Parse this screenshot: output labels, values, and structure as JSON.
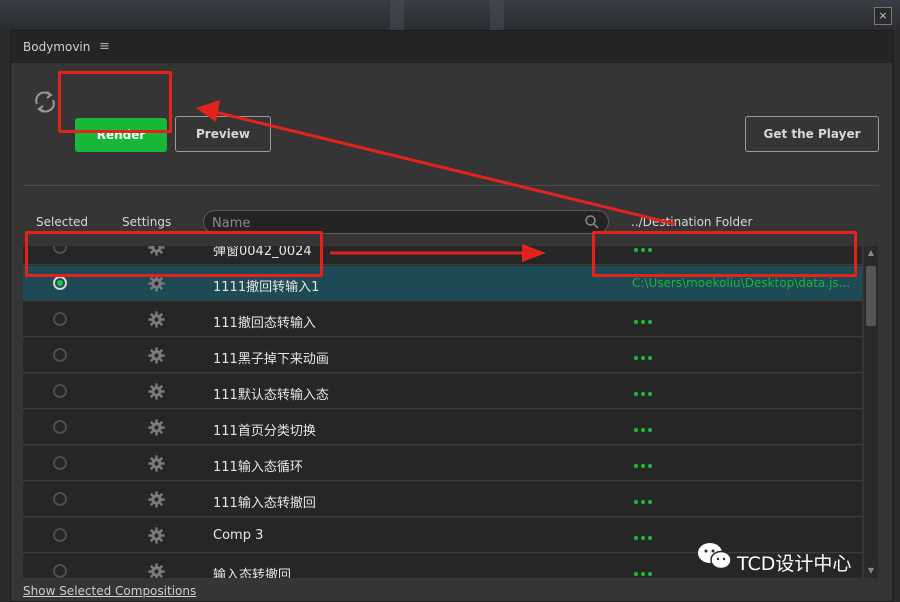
{
  "panel": {
    "title": "Bodymovin",
    "menu_icon": "≡",
    "close_icon": "×"
  },
  "toolbar": {
    "render_label": "Render",
    "preview_label": "Preview",
    "player_label": "Get the Player"
  },
  "columns": {
    "selected": "Selected",
    "settings": "Settings",
    "name_placeholder": "Name",
    "destination": "../Destination Folder"
  },
  "rows": [
    {
      "name": "弹窗0042_0024",
      "selected": false,
      "dest": ""
    },
    {
      "name": "1111撤回转输入1",
      "selected": true,
      "dest": "C:\\Users\\moekoliu\\Desktop\\data.js..."
    },
    {
      "name": "111撤回态转输入",
      "selected": false,
      "dest": ""
    },
    {
      "name": "111黑子掉下来动画",
      "selected": false,
      "dest": ""
    },
    {
      "name": "111默认态转输入态",
      "selected": false,
      "dest": ""
    },
    {
      "name": "111首页分类切换",
      "selected": false,
      "dest": ""
    },
    {
      "name": "111输入态循环",
      "selected": false,
      "dest": ""
    },
    {
      "name": "111输入态转撤回",
      "selected": false,
      "dest": ""
    },
    {
      "name": "Comp 3",
      "selected": false,
      "dest": ""
    },
    {
      "name": "输入态转撤回",
      "selected": false,
      "dest": ""
    }
  ],
  "footer": {
    "show_selected": "Show Selected Compositions"
  },
  "watermark": {
    "text": "TCD设计中心"
  },
  "colors": {
    "accent_green": "#17b83a",
    "highlight_red": "#e3231b",
    "selected_row": "#1d4a55"
  }
}
